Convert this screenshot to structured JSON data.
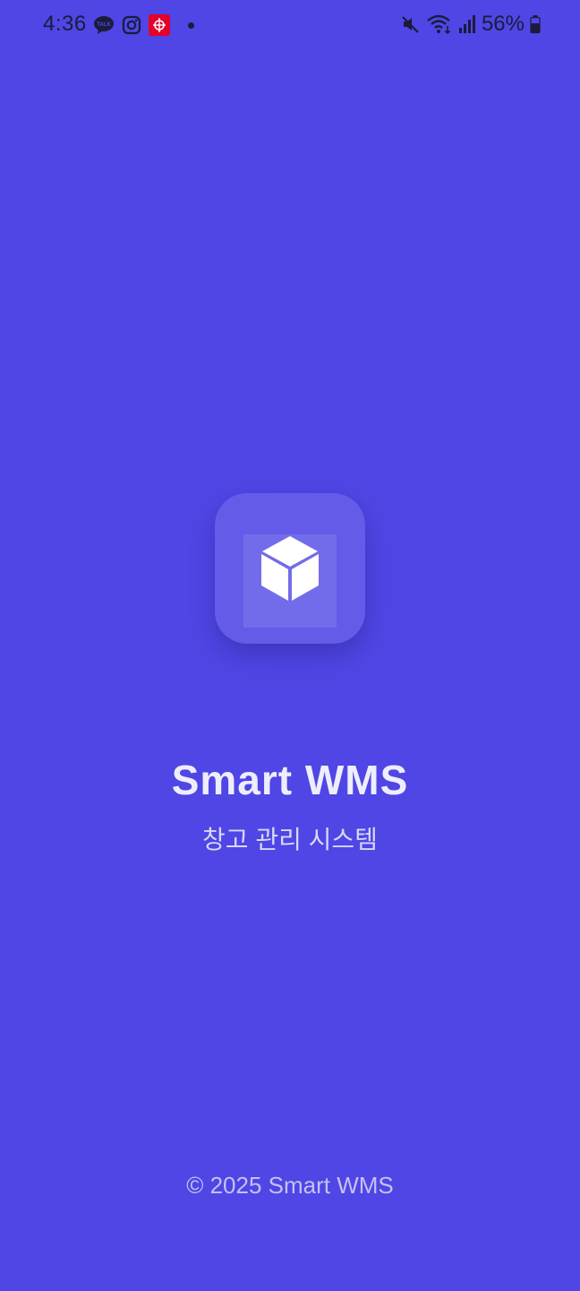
{
  "status_bar": {
    "time": "4:36",
    "battery_percent": "56%",
    "left_icons": [
      "kakaotalk-icon",
      "instagram-icon",
      "red-app-icon",
      "notification-dot"
    ],
    "right_icons": [
      "mute-icon",
      "wifi-icon",
      "signal-icon",
      "battery-icon"
    ]
  },
  "splash": {
    "logo_icon": "cube-icon",
    "title": "Smart WMS",
    "subtitle": "창고 관리 시스템"
  },
  "footer": {
    "copyright": "© 2025 Smart WMS"
  },
  "colors": {
    "background": "#4F46E5",
    "title": "#EEEDFB",
    "subtitle": "#D9D7F7",
    "footer": "#C4C1F3",
    "status_text": "#1B1B3A"
  }
}
